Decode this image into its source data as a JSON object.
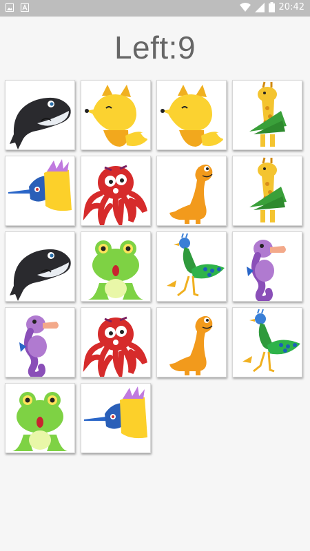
{
  "status_bar": {
    "time": "20:42",
    "left_icons": [
      "image-icon",
      "text-icon"
    ],
    "right_icons": [
      "wifi-icon",
      "signal-icon",
      "battery-icon"
    ]
  },
  "header": {
    "title": "Left:9"
  },
  "board": {
    "cards": [
      {
        "animal": "whale"
      },
      {
        "animal": "fox"
      },
      {
        "animal": "fox"
      },
      {
        "animal": "giraffe"
      },
      {
        "animal": "fish"
      },
      {
        "animal": "octopus"
      },
      {
        "animal": "dinosaur"
      },
      {
        "animal": "giraffe"
      },
      {
        "animal": "whale"
      },
      {
        "animal": "frog"
      },
      {
        "animal": "peacock"
      },
      {
        "animal": "seahorse"
      },
      {
        "animal": "seahorse"
      },
      {
        "animal": "octopus"
      },
      {
        "animal": "dinosaur"
      },
      {
        "animal": "peacock"
      },
      {
        "animal": "frog"
      },
      {
        "animal": "fish"
      }
    ]
  },
  "colors": {
    "background": "#f6f6f6",
    "status_bar": "#bdbdbd",
    "title_text": "#666666",
    "card": "#ffffff"
  }
}
